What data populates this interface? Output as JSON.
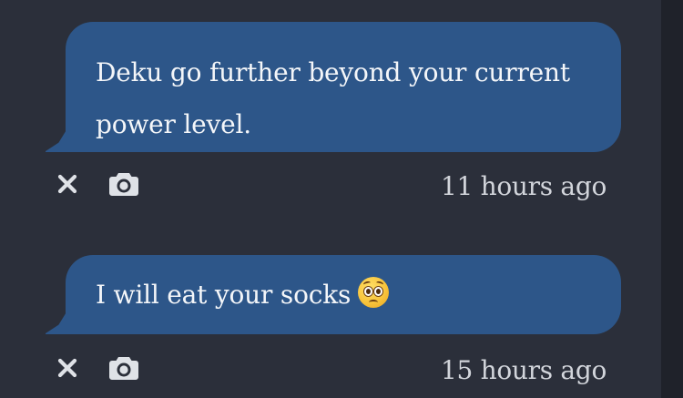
{
  "messages": [
    {
      "text": "Deku go further beyond your current power level.",
      "timestamp": "11 hours ago",
      "delete_icon": "close-icon",
      "screenshot_icon": "camera-icon"
    },
    {
      "text": "I will eat your socks",
      "emoji": "pleading-face",
      "timestamp": "15 hours ago",
      "delete_icon": "close-icon",
      "screenshot_icon": "camera-icon"
    }
  ],
  "colors": {
    "background": "#2b2f3a",
    "bubble": "#2d5689",
    "bubble_text": "#f4f6f9",
    "icon": "#dfe2e7",
    "timestamp": "#d2d5db"
  }
}
